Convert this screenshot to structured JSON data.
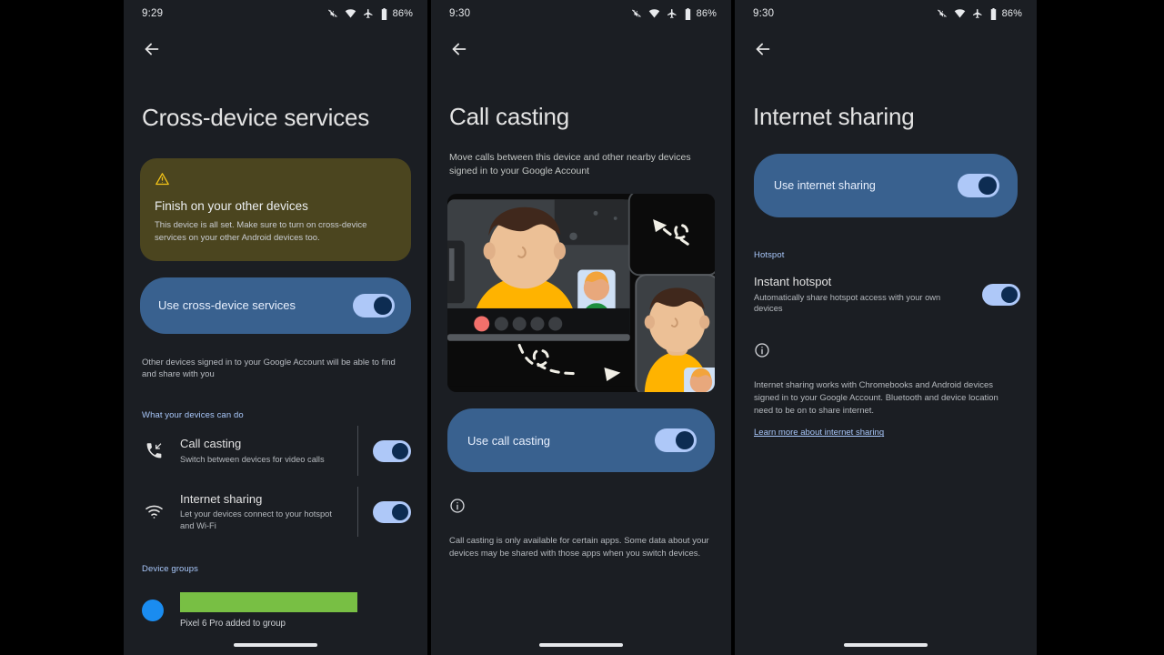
{
  "panels": [
    {
      "statusbar": {
        "time": "9:29",
        "battery": "86%"
      },
      "title": "Cross-device services",
      "warning": {
        "title": "Finish on your other devices",
        "body": "This device is all set. Make sure to turn on cross-device services on your other Android devices too."
      },
      "main_toggle": {
        "label": "Use cross-device services",
        "state": "on"
      },
      "note": "Other devices signed in to your Google Account will be able to find and share with you",
      "section_header": "What your devices can do",
      "rows": [
        {
          "icon": "phone-callback-icon",
          "title": "Call casting",
          "subtitle": "Switch between devices for video calls",
          "state": "on"
        },
        {
          "icon": "wifi-icon",
          "title": "Internet sharing",
          "subtitle": "Let your devices connect to your hotspot and Wi-Fi",
          "state": "on"
        }
      ],
      "device_groups_header": "Device groups",
      "device_group_caption": "Pixel 6 Pro added to group"
    },
    {
      "statusbar": {
        "time": "9:30",
        "battery": "86%"
      },
      "title": "Call casting",
      "subtitle": "Move calls between this device and other nearby devices signed in to your Google Account",
      "main_toggle": {
        "label": "Use call casting",
        "state": "on"
      },
      "info_body": "Call casting is only available for certain apps. Some data about your devices may be shared with those apps when you switch devices."
    },
    {
      "statusbar": {
        "time": "9:30",
        "battery": "86%"
      },
      "title": "Internet sharing",
      "main_toggle": {
        "label": "Use internet sharing",
        "state": "on"
      },
      "section_header": "Hotspot",
      "rows": [
        {
          "title": "Instant hotspot",
          "subtitle": "Automatically share hotspot access with your own devices",
          "state": "on"
        }
      ],
      "info_body": "Internet sharing works with Chromebooks and Android devices signed in to your Google Account. Bluetooth and device location need to be on to share internet.",
      "learn_more": "Learn more about internet sharing"
    }
  ],
  "colors": {
    "accent_blue": "#a8c7fa",
    "card_blue": "#39618f",
    "warn_card": "#4b451f",
    "switch_track": "#aec8f8",
    "switch_knob": "#0d2c52",
    "redaction_green": "#78bf44",
    "avatar_blue": "#1a8cf0",
    "background": "#1b1e23"
  }
}
